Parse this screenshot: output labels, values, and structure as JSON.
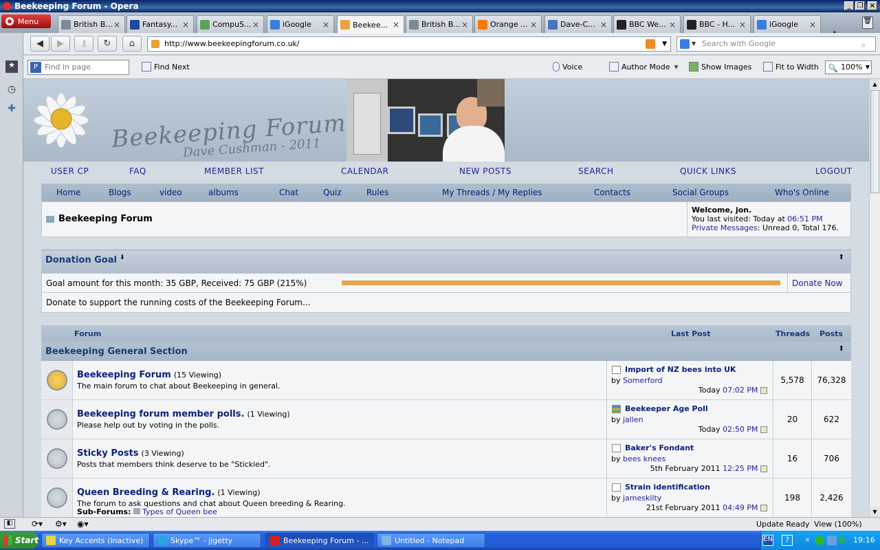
{
  "window": {
    "title": "Beekeeping Forum - Opera"
  },
  "browser": {
    "menu_label": "Menu",
    "tabs": [
      {
        "label": "British B...",
        "color": "#7d8a96"
      },
      {
        "label": "Fantasy...",
        "color": "#1d4a9c"
      },
      {
        "label": "CompuS...",
        "color": "#5aa35a"
      },
      {
        "label": "iGoogle",
        "color": "#3a7de0"
      },
      {
        "label": "Beekee...",
        "color": "#e8a33c"
      },
      {
        "label": "British B...",
        "color": "#7d8a96"
      },
      {
        "label": "Orange ...",
        "color": "#ff7900"
      },
      {
        "label": "Dave-C...",
        "color": "#4a74b8"
      },
      {
        "label": "BBC We...",
        "color": "#222222"
      },
      {
        "label": "BBC - H...",
        "color": "#222222"
      },
      {
        "label": "iGoogle",
        "color": "#3a7de0"
      }
    ],
    "active_tab_index": 4,
    "address": "http://www.beekeepingforum.co.uk/",
    "search_placeholder": "Search with Google",
    "find_placeholder": "Find in page",
    "find_next": "Find Next",
    "voice": "Voice",
    "author_mode": "Author Mode",
    "show_images": "Show Images",
    "fit_to_width": "Fit to Width",
    "zoom": "100%"
  },
  "site": {
    "logo_title": "Beekeeping Forum",
    "logo_sub": "Dave Cushman - 2011",
    "top_nav": [
      "USER CP",
      "FAQ",
      "MEMBER LIST",
      "CALENDAR",
      "NEW POSTS",
      "SEARCH",
      "QUICK LINKS",
      "LOGOUT"
    ],
    "sub_nav": [
      "Home",
      "Blogs",
      "video",
      "albums",
      "Chat",
      "Quiz",
      "Rules",
      "My Threads / My Replies",
      "Contacts",
      "Social Groups",
      "Who's Online"
    ],
    "breadcrumb": "Beekeeping Forum",
    "welcome": {
      "greeting": "Welcome, jon.",
      "last_visited_prefix": "You last visited: Today at ",
      "last_visited_time": "06:51 PM",
      "pm_link": "Private Messages",
      "pm_text": ": Unread 0, Total 176."
    }
  },
  "donation": {
    "title": "Donation Goal",
    "goal_text": "Goal amount for this month: 35 GBP, Received: 75 GBP (215%)",
    "progress_percent": 215,
    "donate_now": "Donate Now",
    "support_text": "Donate to support the running costs of the Beekeeping Forum..."
  },
  "forum_table": {
    "columns": {
      "forum": "Forum",
      "last_post": "Last Post",
      "threads": "Threads",
      "posts": "Posts"
    },
    "section_title": "Beekeeping General Section",
    "rows": [
      {
        "name": "Beekeeping Forum",
        "viewing": "(15 Viewing)",
        "desc": "The main forum to chat about Beekeeping in general.",
        "last_post_title": "Import of NZ bees into UK",
        "by": "by ",
        "author": "Somerford",
        "date": "Today ",
        "time": "07:02 PM",
        "threads": "5,578",
        "posts": "76,328",
        "new": true
      },
      {
        "name": "Beekeeping forum member polls.",
        "viewing": "(1 Viewing)",
        "desc": "Please help out by voting in the polls.",
        "last_post_title": "Beekeeper Age Poll",
        "by": "by ",
        "author": "jallen",
        "date": "Today ",
        "time": "02:50 PM",
        "threads": "20",
        "posts": "622",
        "new": false
      },
      {
        "name": "Sticky Posts",
        "viewing": "(3 Viewing)",
        "desc": "Posts that members think deserve to be \"Stickied\".",
        "last_post_title": "Baker's Fondant",
        "by": "by ",
        "author": "bees knees",
        "date": "5th February 2011 ",
        "time": "12:25 PM",
        "threads": "16",
        "posts": "706",
        "new": false
      },
      {
        "name": "Queen Breeding & Rearing.",
        "viewing": "(1 Viewing)",
        "desc": "The forum to ask questions and chat about Queen breeding & Rearing.",
        "sub_forums_label": "Sub-Forums:",
        "sub_forum": "Types of Queen bee",
        "last_post_title": "Strain identification",
        "by": "by ",
        "author": "jameskilty",
        "date": "21st February 2011 ",
        "time": "04:49 PM",
        "threads": "198",
        "posts": "2,426",
        "new": false
      }
    ]
  },
  "statusbar": {
    "status": "Update Ready",
    "view": "View (100%)"
  },
  "taskbar": {
    "start": "Start",
    "tasks": [
      {
        "label": "Key Accents (Inactive)",
        "color": "#e6d23c"
      },
      {
        "label": "Skype™ - jjgetty",
        "color": "#2aa3e0"
      },
      {
        "label": "Beekeeping Forum - ...",
        "color": "#d42020"
      },
      {
        "label": "Untitled - Notepad",
        "color": "#7fb2e5"
      }
    ],
    "lang": "EN",
    "clock": "19:16"
  }
}
